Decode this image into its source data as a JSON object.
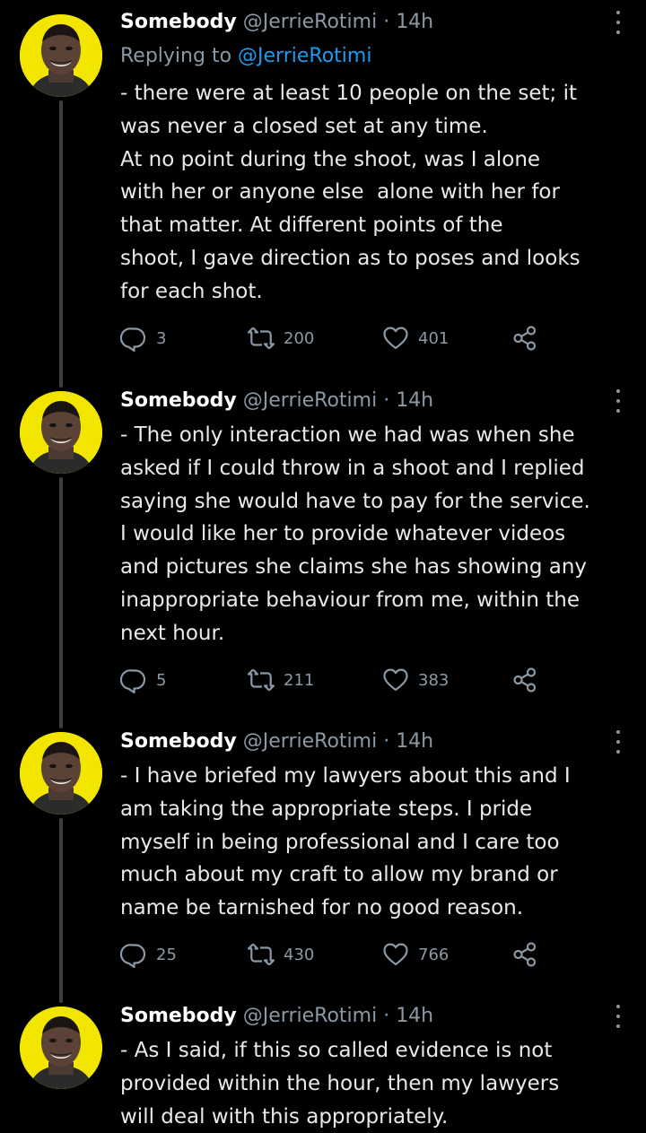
{
  "tweets": [
    {
      "name": "Somebody",
      "handle": "@JerrieRotimi",
      "dot": "·",
      "time": "14h",
      "replying_prefix": "Replying to",
      "replying_handle": "@JerrieRotimi",
      "text": "- there were at least 10 people on the set; it\nwas never a closed set at any time.\nAt no point during the shoot, was I alone\nwith her or anyone else  alone with her for\nthat matter. At different points of the\nshoot, I gave direction as to poses and looks\nfor each shot.",
      "replies": "3",
      "retweets": "200",
      "likes": "401"
    },
    {
      "name": "Somebody",
      "handle": "@JerrieRotimi",
      "dot": "·",
      "time": "14h",
      "text": "- The only interaction we had was when she\nasked if I could throw in a shoot and I replied\nsaying she would have to pay for the service.\nI would like her to provide whatever videos\nand pictures she claims she has showing any\ninappropriate behaviour from me, within the\nnext hour.",
      "replies": "5",
      "retweets": "211",
      "likes": "383"
    },
    {
      "name": "Somebody",
      "handle": "@JerrieRotimi",
      "dot": "·",
      "time": "14h",
      "text": "- I have briefed my lawyers about this and I\nam taking the appropriate steps. I pride\nmyself in being professional and I care too\nmuch about my craft to allow my brand or\nname be tarnished for no good reason.",
      "replies": "25",
      "retweets": "430",
      "likes": "766"
    },
    {
      "name": "Somebody",
      "handle": "@JerrieRotimi",
      "dot": "·",
      "time": "14h",
      "text": "- As I said, if this so called evidence is not\nprovided within the hour, then my lawyers\nwill deal with this appropriately."
    }
  ],
  "colors": {
    "background": "#000000",
    "text": "#e7e9ea",
    "muted": "#8b98a5",
    "link": "#1d9bf0",
    "avatar_bg": "#f2e600",
    "thread_line": "#3a3f44"
  },
  "icons": [
    "reply-icon",
    "retweet-icon",
    "like-icon",
    "share-icon",
    "more-icon"
  ]
}
